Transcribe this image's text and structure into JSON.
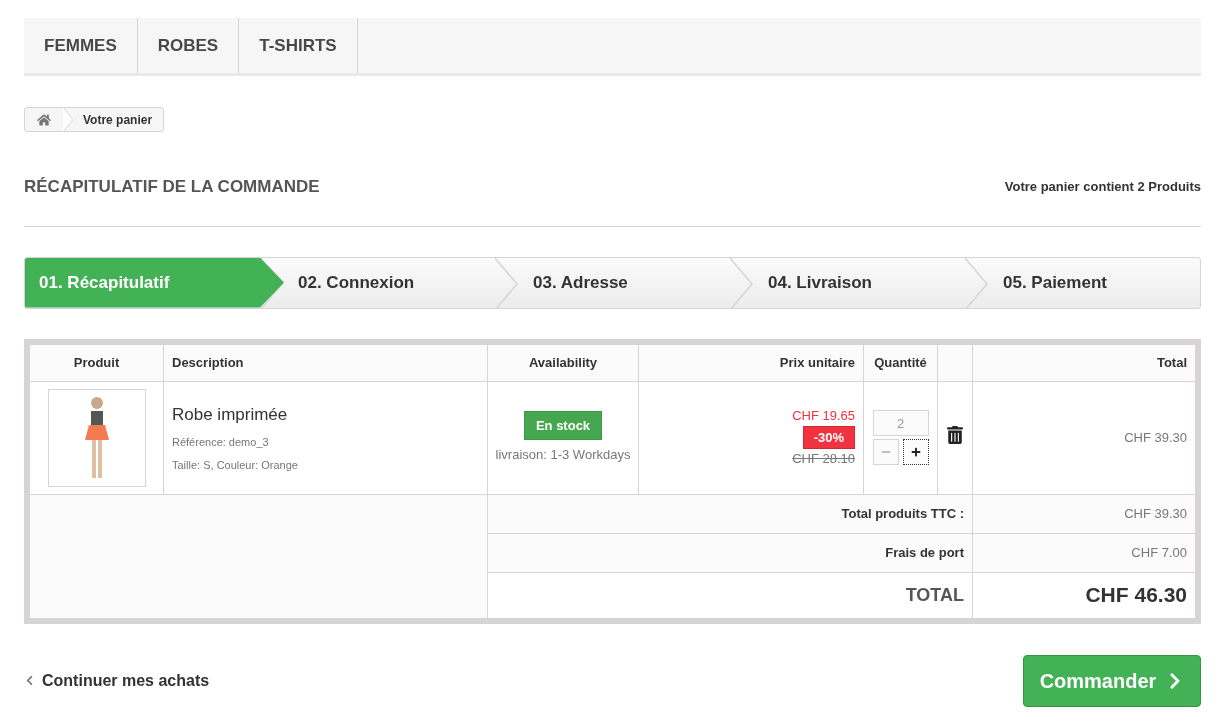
{
  "menu": [
    {
      "label": "FEMMES"
    },
    {
      "label": "ROBES"
    },
    {
      "label": "T-SHIRTS"
    }
  ],
  "breadcrumb": {
    "current": "Votre panier"
  },
  "heading": {
    "title": "RÉCAPITULATIF DE LA COMMANDE",
    "count": "Votre panier contient 2 Produits"
  },
  "steps": [
    {
      "label": "01. Récapitulatif",
      "selected": true
    },
    {
      "label": "02. Connexion",
      "selected": false
    },
    {
      "label": "03. Adresse",
      "selected": false
    },
    {
      "label": "04. Livraison",
      "selected": false
    },
    {
      "label": "05. Paiement",
      "selected": false
    }
  ],
  "table": {
    "columns": [
      "Produit",
      "Description",
      "Availability",
      "Prix unitaire",
      "Quantité",
      "Total"
    ],
    "rows": [
      {
        "name": "Robe imprimée",
        "reference": "Référence: demo_3",
        "attributes": "Taille: S, Couleur: Orange",
        "availability": {
          "label": "En stock",
          "kind": "in_stock"
        },
        "delivery": "livraison: 1-3 Workdays",
        "price": "CHF 19.65",
        "discount": "-30%",
        "old_price": "CHF 28.10",
        "quantity": "2",
        "minus_disabled": true,
        "total": "CHF 39.30"
      }
    ],
    "summary": [
      {
        "label": "Total produits TTC :",
        "value": "CHF 39.30",
        "kind": "line"
      },
      {
        "label": "Frais de port",
        "value": "CHF 7.00",
        "kind": "line"
      },
      {
        "label": "TOTAL",
        "value": "CHF 46.30",
        "kind": "grand"
      }
    ]
  },
  "actions": {
    "continue": "Continuer mes achats",
    "checkout": "Commander"
  }
}
